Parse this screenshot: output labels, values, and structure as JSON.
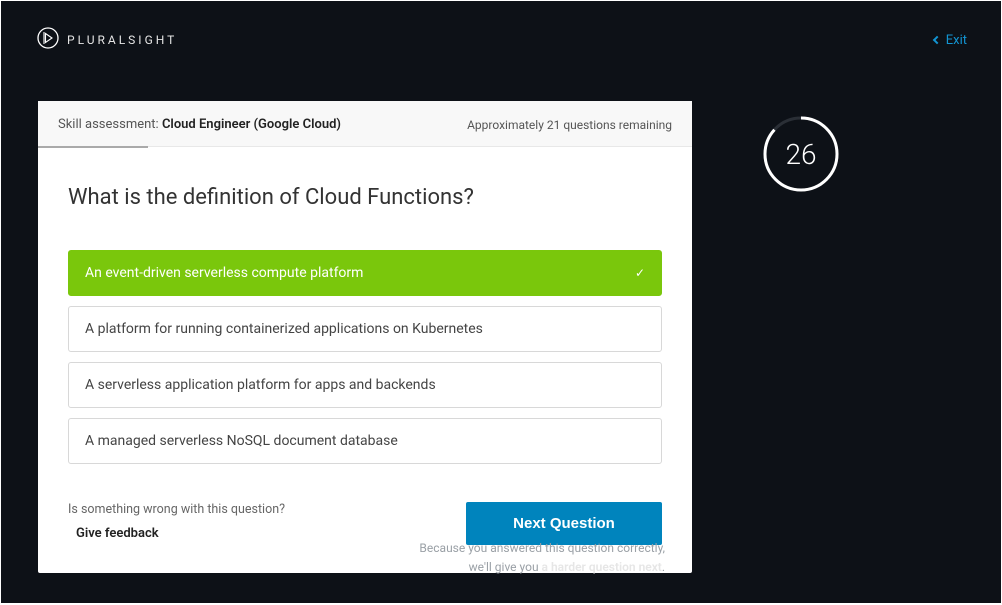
{
  "header": {
    "brand": "PLURALSIGHT",
    "exit": "Exit"
  },
  "assessment": {
    "label_prefix": "Skill assessment:",
    "name": "Cloud Engineer (Google Cloud)",
    "remaining": "Approximately 21 questions remaining"
  },
  "question": {
    "text": "What is the definition of Cloud Functions?",
    "options": [
      {
        "text": "An event-driven serverless compute platform",
        "selected": true
      },
      {
        "text": "A platform for running containerized applications on Kubernetes",
        "selected": false
      },
      {
        "text": "A serverless application platform for apps and backends",
        "selected": false
      },
      {
        "text": "A managed serverless NoSQL document database",
        "selected": false
      }
    ]
  },
  "feedback": {
    "prompt": "Is something wrong with this question?",
    "link": "Give feedback"
  },
  "next_button": "Next Question",
  "timer": {
    "value": "26"
  },
  "result": {
    "line1": "Because you answered this question correctly,",
    "line2_pre": "we'll give you ",
    "line2_bold": "a harder question next",
    "line2_post": "."
  }
}
